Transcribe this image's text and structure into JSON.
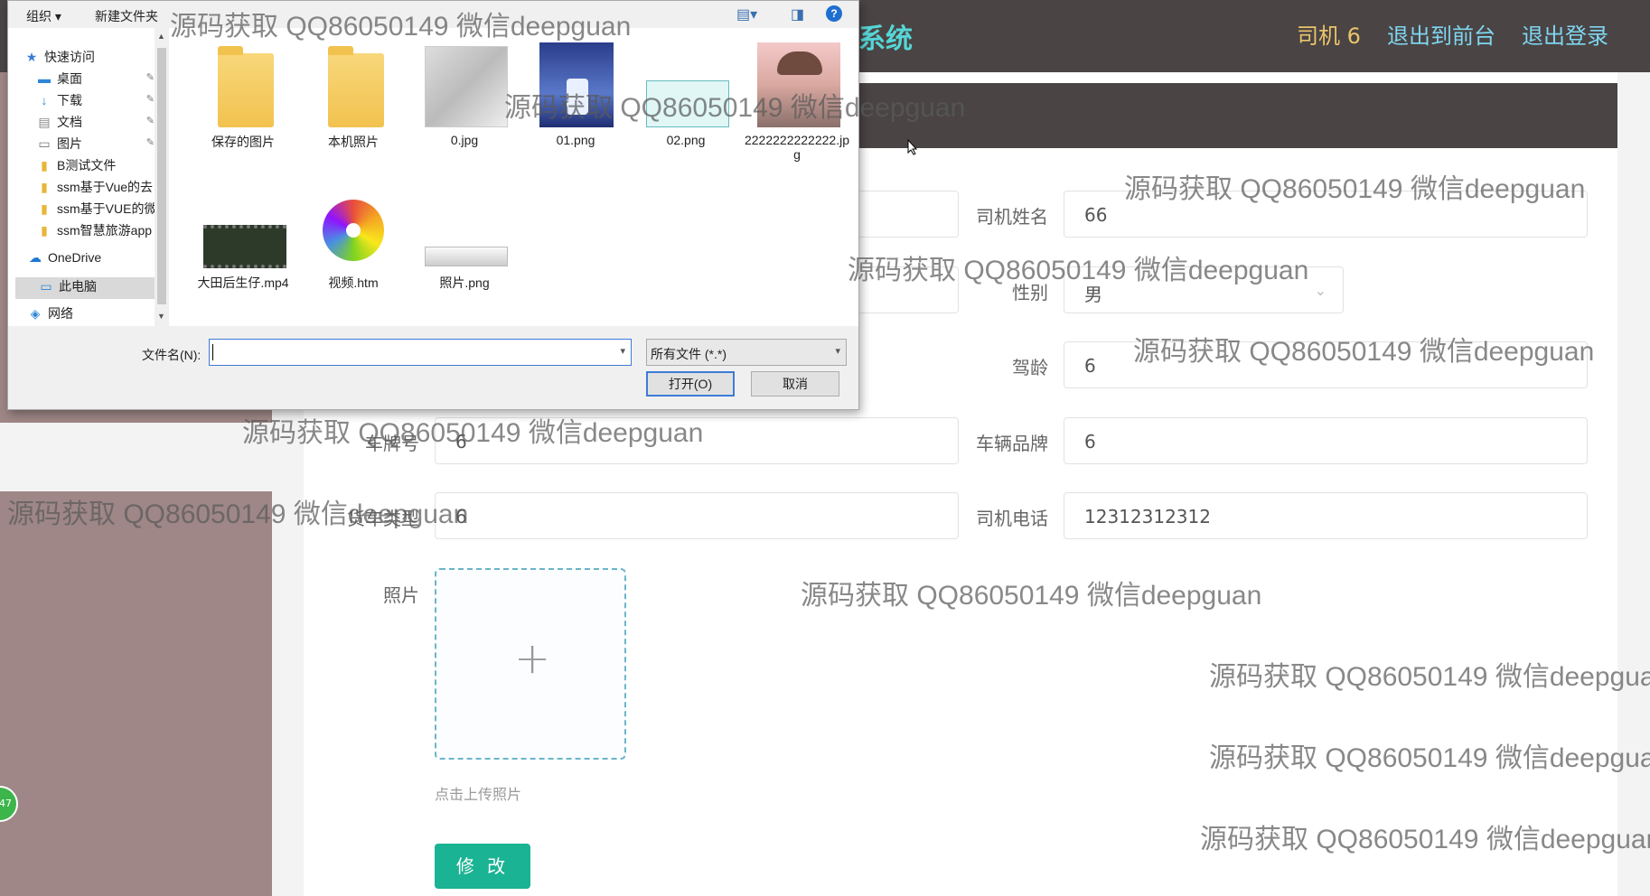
{
  "header": {
    "title": "系统",
    "nav": {
      "driver": "司机 6",
      "front": "退出到前台",
      "logout": "退出登录"
    }
  },
  "form": {
    "driver_name": {
      "label": "司机姓名",
      "value": "66"
    },
    "gender": {
      "label": "性别",
      "value": "男"
    },
    "driving_years": {
      "label": "驾龄",
      "value": "6"
    },
    "plate": {
      "label": "车牌号",
      "value": "6"
    },
    "brand": {
      "label": "车辆品牌",
      "value": "6"
    },
    "vehicle_type": {
      "label": "货车类型",
      "value": "6"
    },
    "phone": {
      "label": "司机电话",
      "value": "12312312312"
    },
    "photo": {
      "label": "照片",
      "hint": "点击上传照片"
    },
    "submit": "修 改"
  },
  "side_badge": "47",
  "dialog": {
    "toolbar": {
      "organize": "组织",
      "new_folder": "新建文件夹"
    },
    "nav": [
      {
        "label": "快速访问",
        "icon": "star-icon"
      },
      {
        "label": "桌面",
        "icon": "desktop-icon"
      },
      {
        "label": "下载",
        "icon": "download-icon"
      },
      {
        "label": "文档",
        "icon": "document-icon"
      },
      {
        "label": "图片",
        "icon": "picture-icon"
      },
      {
        "label": "B测试文件",
        "icon": "folder-icon"
      },
      {
        "label": "ssm基于Vue的去",
        "icon": "folder-icon"
      },
      {
        "label": "ssm基于VUE的微",
        "icon": "folder-icon"
      },
      {
        "label": "ssm智慧旅游app",
        "icon": "folder-icon"
      },
      {
        "label": "OneDrive",
        "icon": "cloud-icon"
      },
      {
        "label": "此电脑",
        "icon": "computer-icon"
      },
      {
        "label": "网络",
        "icon": "network-icon"
      }
    ],
    "files": [
      {
        "name": "保存的图片",
        "kind": "folder"
      },
      {
        "name": "本机照片",
        "kind": "folder"
      },
      {
        "name": "0.jpg",
        "kind": "image"
      },
      {
        "name": "01.png",
        "kind": "image"
      },
      {
        "name": "02.png",
        "kind": "image"
      },
      {
        "name": "2222222222222.jpg",
        "kind": "image"
      },
      {
        "name": "大田后生仔.mp4",
        "kind": "video"
      },
      {
        "name": "视频.htm",
        "kind": "html"
      },
      {
        "name": "照片.png",
        "kind": "image"
      }
    ],
    "filename_label": "文件名(N):",
    "filename_value": "",
    "filetype": "所有文件 (*.*)",
    "open": "打开(O)",
    "cancel": "取消"
  },
  "watermark": "源码获取 QQ86050149 微信deepguan"
}
